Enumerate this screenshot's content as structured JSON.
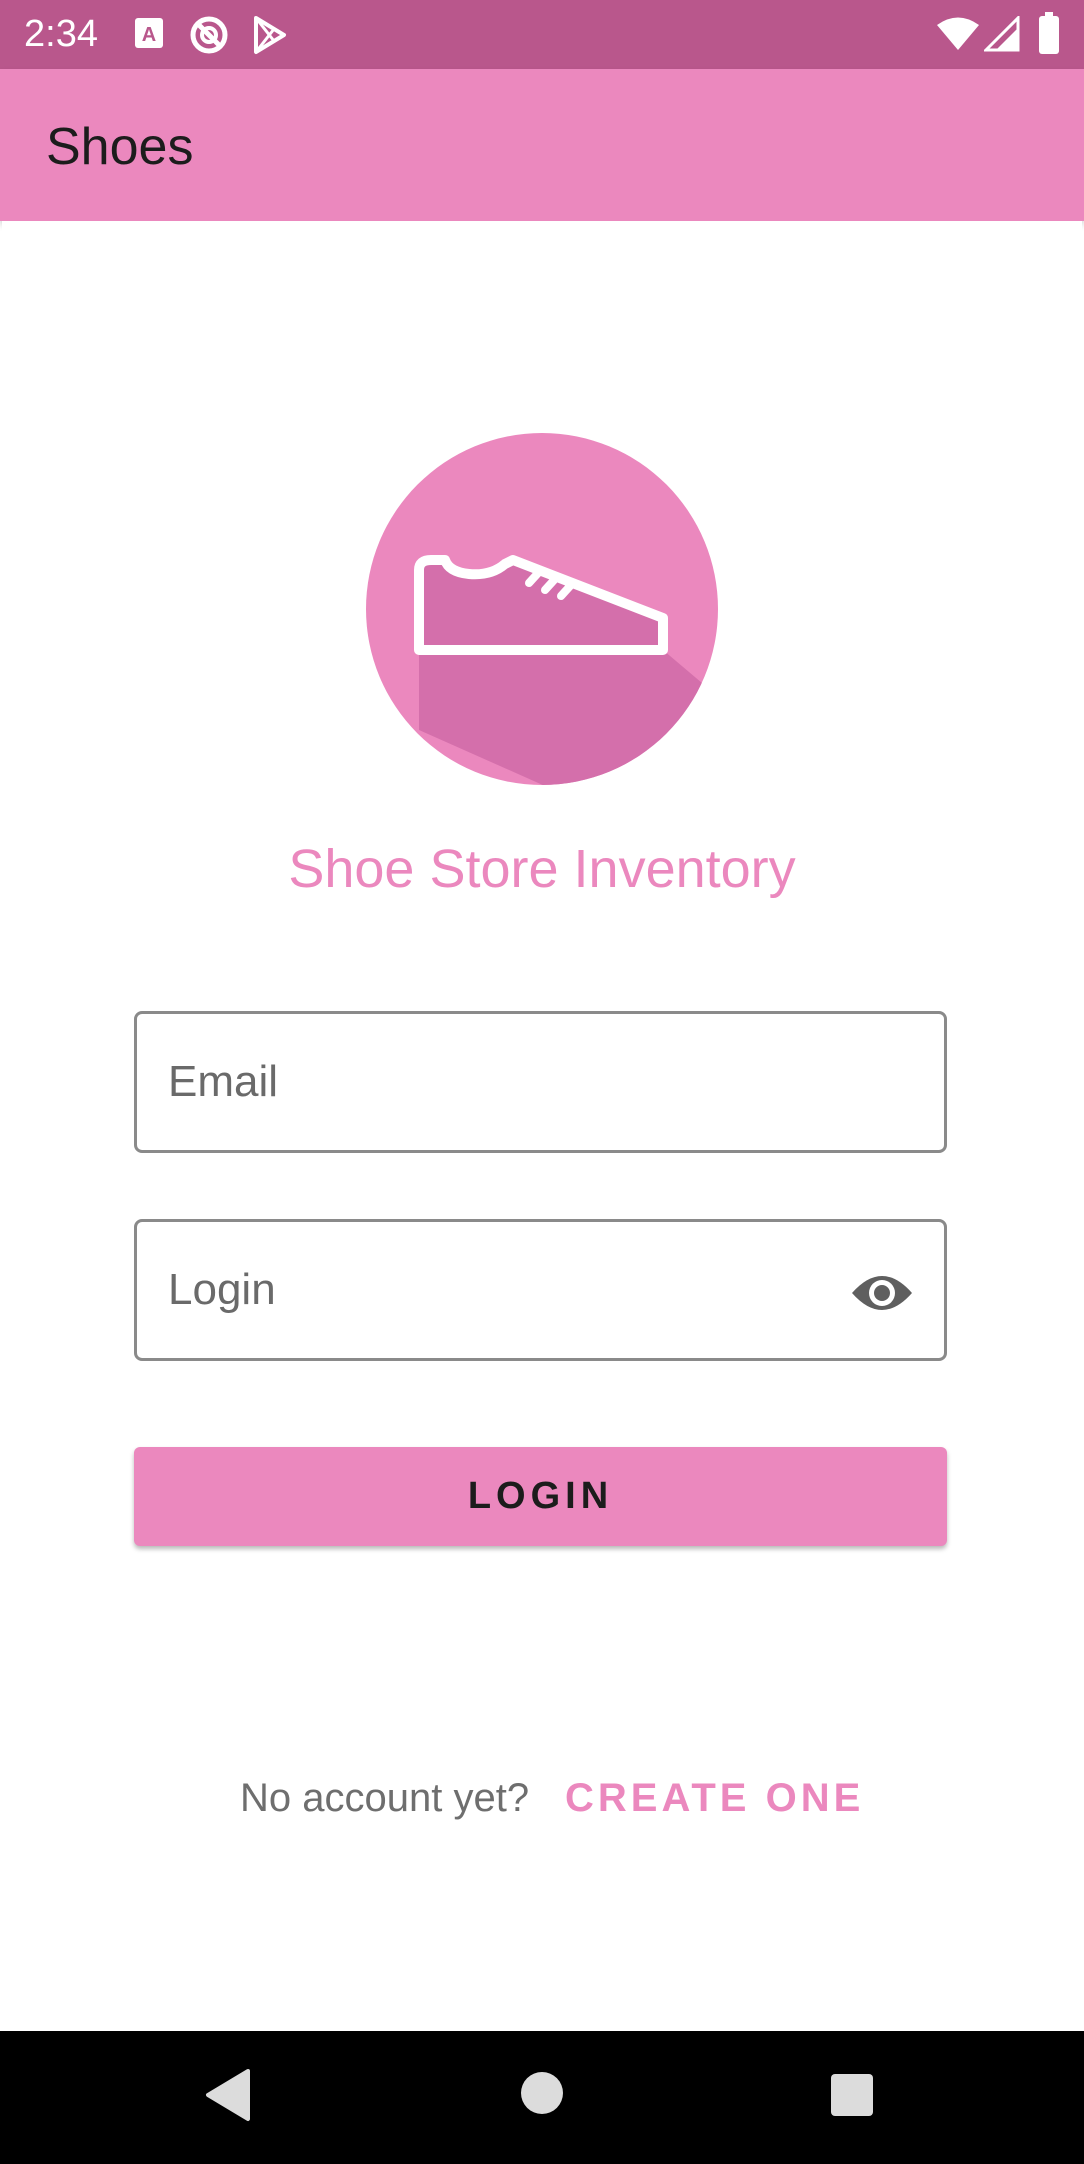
{
  "status_bar": {
    "time": "2:34",
    "left_icons": [
      "a-notification-icon",
      "sync-icon",
      "play-store-icon"
    ],
    "right_icons": [
      "wifi-icon",
      "signal-icon",
      "battery-icon"
    ],
    "background_color": "#b9578c"
  },
  "app_bar": {
    "title": "Shoes",
    "background_color": "#eb88be"
  },
  "logo": {
    "icon": "shoe-icon",
    "circle_color": "#eb88be",
    "shadow_color": "#d46fab"
  },
  "subtitle": "Shoe Store Inventory",
  "form": {
    "email_label": "Email",
    "password_label": "Login",
    "password_toggle_icon": "eye-icon",
    "login_button": "LOGIN"
  },
  "footer": {
    "prompt": "No account yet?",
    "create_link": "CREATE ONE"
  },
  "nav_bar": {
    "buttons": [
      "back-icon",
      "home-icon",
      "recents-icon"
    ]
  }
}
